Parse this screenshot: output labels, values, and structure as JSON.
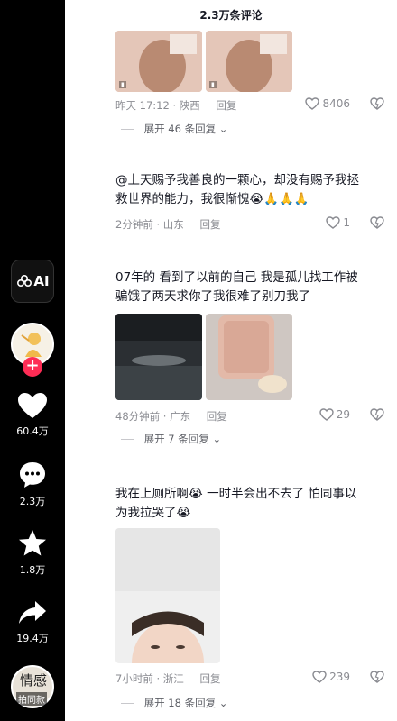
{
  "panel": {
    "title": "2.3万条评论"
  },
  "rail": {
    "ai_label": "AI",
    "like_count": "60.4万",
    "comment_count": "2.3万",
    "favorite_count": "1.8万",
    "share_count": "19.4万",
    "bottom_glyph": "情感",
    "bottom_label": "拍同款"
  },
  "comments": [
    {
      "meta_time": "昨天 17:12 · 陕西",
      "reply_label": "回复",
      "likes": "8406",
      "expand": "展开 46 条回复"
    },
    {
      "text": "@上天赐予我善良的一颗心，却没有赐予我拯救世界的能力，我很惭愧😭🙏🙏🙏",
      "meta_time": "2分钟前 · 山东",
      "reply_label": "回复",
      "likes": "1"
    },
    {
      "text": "07年的 看到了以前的自己 我是孤儿找工作被骗饿了两天求你了我很难了别刀我了",
      "meta_time": "48分钟前 · 广东",
      "reply_label": "回复",
      "likes": "29",
      "expand": "展开 7 条回复"
    },
    {
      "text": "我在上厕所啊😭 一时半会出不去了 怕同事以为我拉哭了😭",
      "meta_time": "7小时前 · 浙江",
      "reply_label": "回复",
      "likes": "239",
      "expand": "展开 18 条回复"
    }
  ],
  "colors": {
    "accent": "#fe2c55",
    "rail_bg": "#000000",
    "muted": "#8a8b91"
  },
  "icons": [
    "ai-icon",
    "heart-icon",
    "comment-icon",
    "star-icon",
    "share-icon",
    "like-heart-icon",
    "dislike-icon",
    "chevron-down-icon"
  ]
}
